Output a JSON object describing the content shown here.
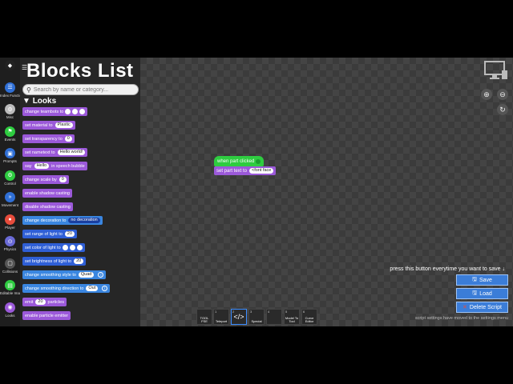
{
  "palette": {
    "title": "Blocks List",
    "search_placeholder": "Search by name or category...",
    "section": "Looks",
    "blocks": [
      {
        "text": "change teambots to",
        "color": "purple",
        "extra": "circles3"
      },
      {
        "text": "set material to",
        "color": "purple",
        "pill": "Plastic"
      },
      {
        "text": "set transparency to",
        "color": "purple",
        "pill": "0"
      },
      {
        "text": "set nametext to",
        "color": "purple",
        "pill": "Hello world!"
      },
      {
        "text": "say",
        "color": "purple",
        "pill": "Hello",
        "suffix": "in speech bubble"
      },
      {
        "text": "change scale by",
        "color": "purple",
        "pill": "0"
      },
      {
        "text": "enable shadow casting",
        "color": "purple"
      },
      {
        "text": "disable shadow casting",
        "color": "purple"
      },
      {
        "text": "change decoration to",
        "color": "lblue",
        "dpill": "no decoration"
      },
      {
        "text": "set range of light to",
        "color": "blue",
        "pill": "20"
      },
      {
        "text": "set color of light to",
        "color": "blue",
        "extra": "circles3"
      },
      {
        "text": "set brightness of light to",
        "color": "blue",
        "pill": "20"
      },
      {
        "text": "change smoothing style to",
        "color": "lblue",
        "pill": "Quad",
        "info": "i"
      },
      {
        "text": "change smoothing direction to",
        "color": "lblue",
        "pill": "Out",
        "info": "i"
      },
      {
        "text": "emit",
        "color": "purple",
        "pill": "20",
        "suffix": "particles"
      },
      {
        "text": "enable particle emitter",
        "color": "purple"
      }
    ]
  },
  "rail": [
    {
      "label": "",
      "color": "#222222",
      "icon": "roblox-icon"
    },
    {
      "label": "Index Functions",
      "color": "#2f6fd6",
      "icon": "list-icon"
    },
    {
      "label": "Misc",
      "color": "#bbbbbb",
      "icon": "gear-icon"
    },
    {
      "label": "Events",
      "color": "#2ecc40",
      "icon": "flag-icon"
    },
    {
      "label": "Prompts",
      "color": "#2f6fd6",
      "icon": "window-icon"
    },
    {
      "label": "Control",
      "color": "#2ecc40",
      "icon": "gear-icon"
    },
    {
      "label": "Movement",
      "color": "#2f6fd6",
      "icon": "arrows-icon"
    },
    {
      "label": "Player",
      "color": "#e74c3c",
      "icon": "person-icon"
    },
    {
      "label": "Physics",
      "color": "#6a6ad6",
      "icon": "gravity-icon"
    },
    {
      "label": "Collisions",
      "color": "#555555",
      "icon": "box-icon"
    },
    {
      "label": "Editable Images",
      "color": "#2ecc40",
      "icon": "image-icon"
    },
    {
      "label": "Looks",
      "color": "#9b59d9",
      "icon": "eye-icon"
    }
  ],
  "workspace": {
    "hat_label": "when part clicked",
    "hat_block_text": "set part text to",
    "hat_block_pill": "<font face"
  },
  "right": {
    "save_hint": "press this button everytime you want to save ↓",
    "save_label": "Save",
    "load_label": "Load",
    "delete_label": "Delete Script",
    "settings_moved": "script settings have moved to the settings menu"
  },
  "hotbar": [
    {
      "num": "",
      "label": "TOOL FSE",
      "selected": false
    },
    {
      "num": "1",
      "label": "Teleport",
      "selected": false
    },
    {
      "num": "2",
      "label": "</>",
      "selected": true
    },
    {
      "num": "3",
      "label": "Special",
      "selected": false
    },
    {
      "num": "4",
      "label": "",
      "selected": false
    },
    {
      "num": "5",
      "label": "Model To Tool",
      "selected": false
    },
    {
      "num": "6",
      "label": "Curve Editor",
      "selected": false
    }
  ]
}
